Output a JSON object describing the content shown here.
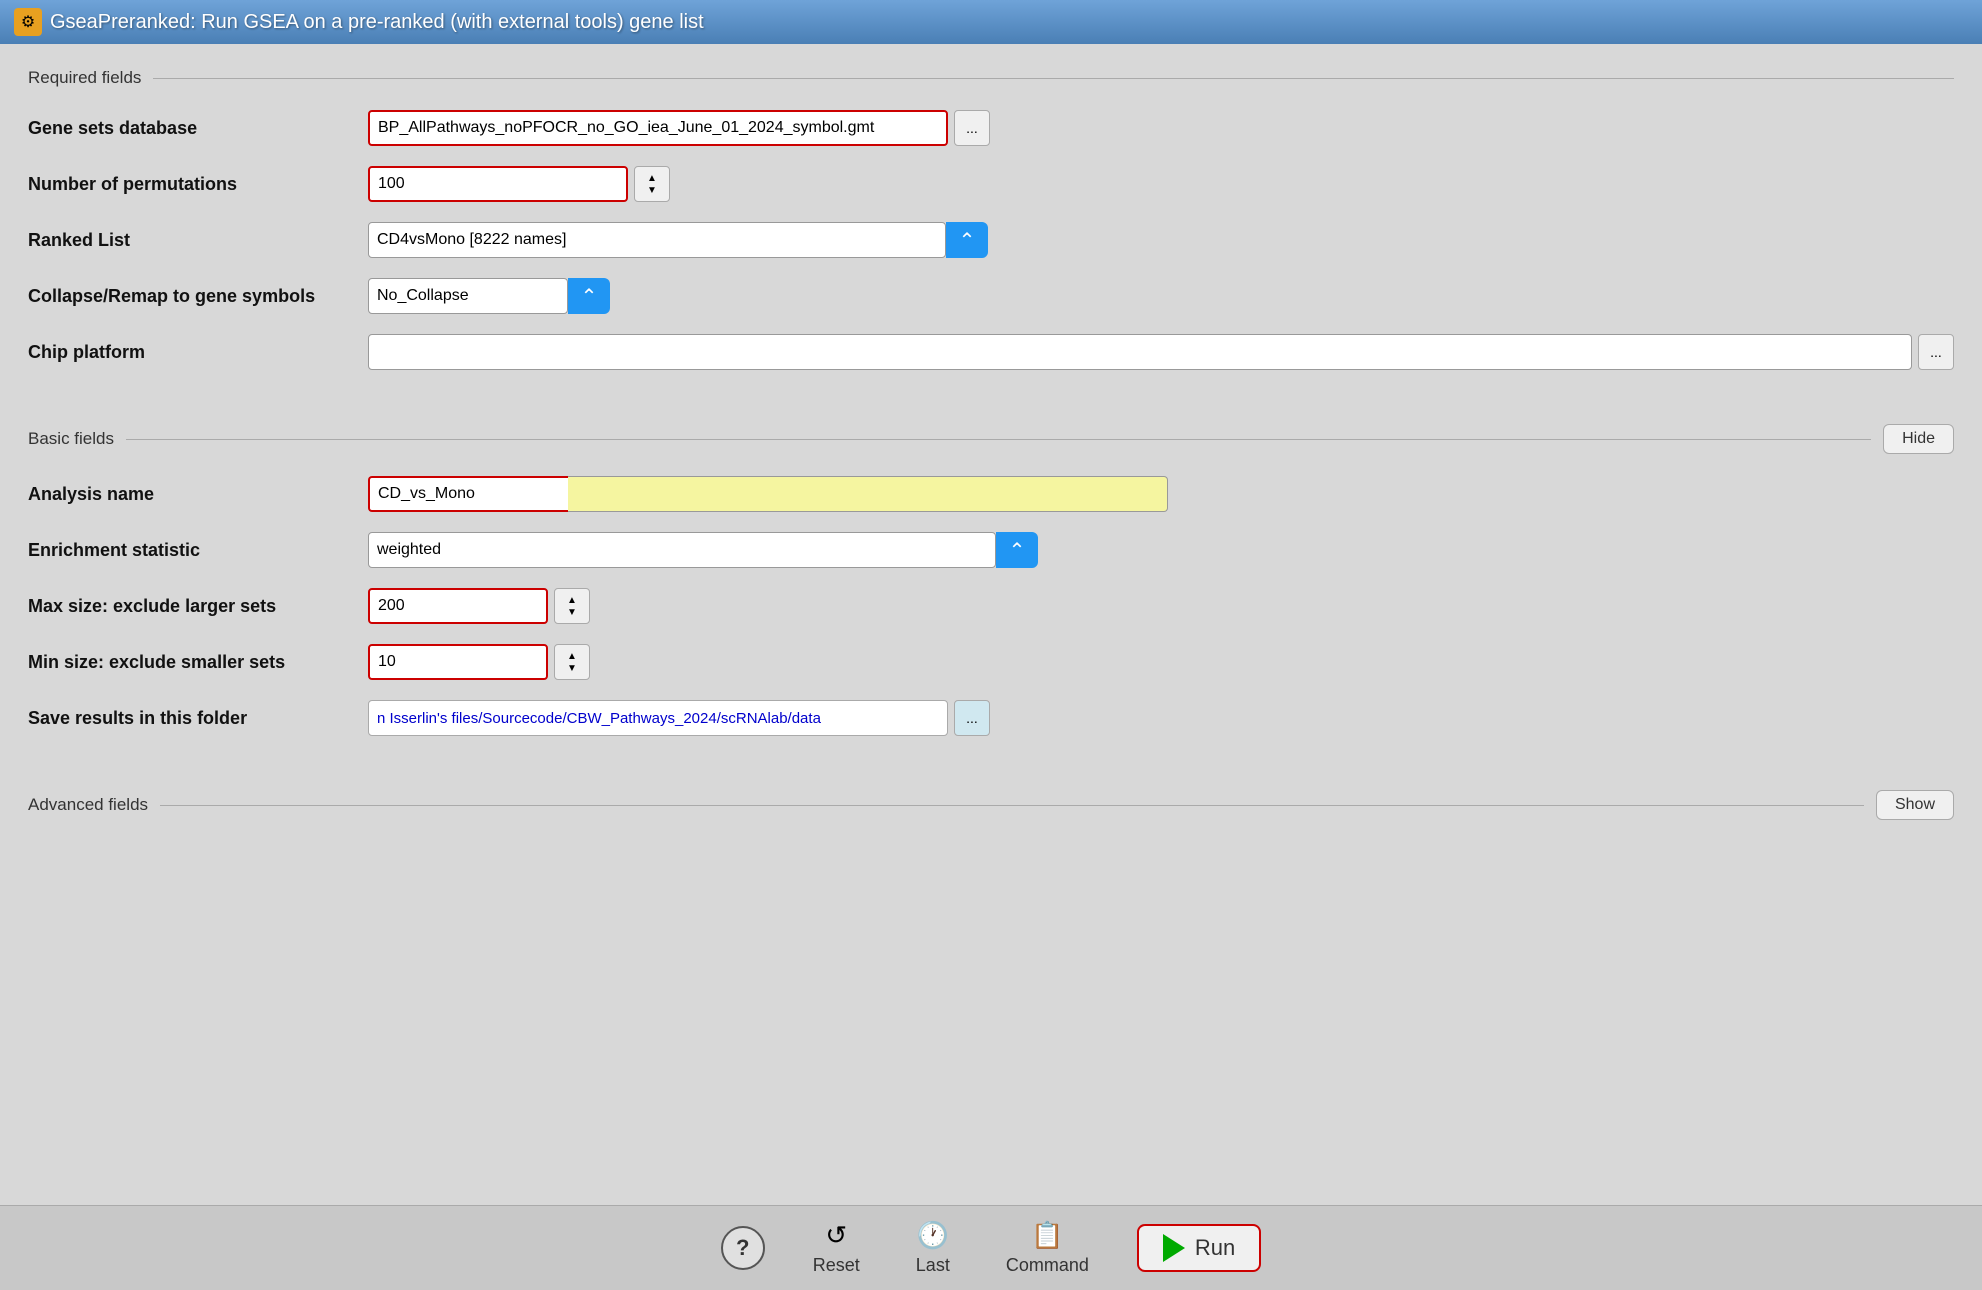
{
  "titleBar": {
    "icon": "⚙",
    "title": "GseaPreranked: Run GSEA on a pre-ranked (with external tools) gene list"
  },
  "requiredFields": {
    "sectionLabel": "Required fields",
    "geneSetsDatabase": {
      "label": "Gene sets database",
      "value": "BP_AllPathways_noPFOCR_no_GO_iea_June_01_2024_symbol.gmt",
      "ellipsisLabel": "..."
    },
    "numberOfPermutations": {
      "label": "Number of permutations",
      "value": "100"
    },
    "rankedList": {
      "label": "Ranked List",
      "value": "CD4vsMono [8222 names]",
      "blueArrow": "⌃"
    },
    "collapseRemap": {
      "label": "Collapse/Remap to gene symbols",
      "value": "No_Collapse",
      "blueArrow": "⌃"
    },
    "chipPlatform": {
      "label": "Chip platform",
      "ellipsisLabel": "..."
    }
  },
  "basicFields": {
    "sectionLabel": "Basic fields",
    "hideLabel": "Hide",
    "analysisName": {
      "label": "Analysis name",
      "value": "CD_vs_Mono"
    },
    "enrichmentStatistic": {
      "label": "Enrichment statistic",
      "value": "weighted",
      "blueArrow": "⌃"
    },
    "maxSize": {
      "label": "Max size: exclude larger sets",
      "value": "200"
    },
    "minSize": {
      "label": "Min size: exclude smaller sets",
      "value": "10"
    },
    "saveResults": {
      "label": "Save results in this folder",
      "value": "n Isserlin's files/Sourcecode/CBW_Pathways_2024/scRNAlab/data",
      "ellipsisLabel": "..."
    }
  },
  "advancedFields": {
    "sectionLabel": "Advanced fields",
    "showLabel": "Show"
  },
  "bottomBar": {
    "helpLabel": "?",
    "resetLabel": "Reset",
    "resetIcon": "↺",
    "lastLabel": "Last",
    "lastIcon": "🕐",
    "commandLabel": "Command",
    "commandIcon": "📋",
    "runLabel": "Run"
  }
}
